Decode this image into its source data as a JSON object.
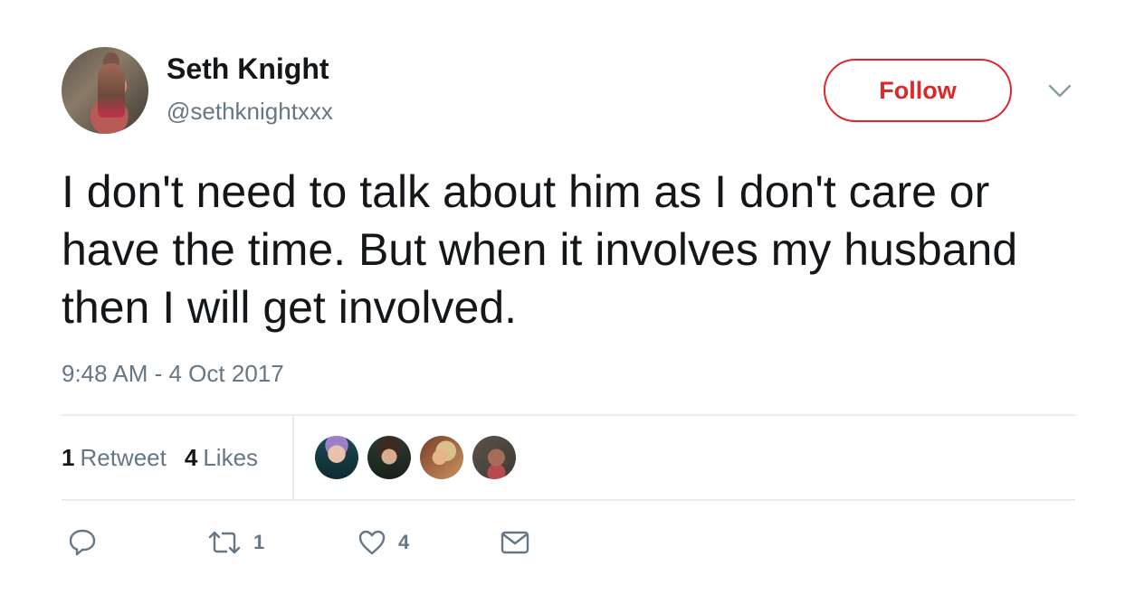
{
  "user": {
    "name": "Seth Knight",
    "handle": "@sethknightxxx",
    "avatar_icon": "user-avatar"
  },
  "follow_button": {
    "label": "Follow",
    "color": "#e0262a"
  },
  "menu_icon": "chevron-down-icon",
  "tweet": {
    "text": "I don't need to talk about him as I don't care or have the time. But when it involves my husband then I will get involved.",
    "timestamp": "9:48 AM - 4 Oct 2017"
  },
  "stats": {
    "retweets_count": "1",
    "retweets_label": "Retweet",
    "likes_count": "4",
    "likes_label": "Likes"
  },
  "likers": [
    {
      "icon": "liker-avatar"
    },
    {
      "icon": "liker-avatar"
    },
    {
      "icon": "liker-avatar"
    },
    {
      "icon": "liker-avatar"
    }
  ],
  "actions": {
    "reply_icon": "reply-icon",
    "retweet_icon": "retweet-icon",
    "retweet_count": "1",
    "like_icon": "heart-icon",
    "like_count": "4",
    "dm_icon": "envelope-icon"
  },
  "colors": {
    "text": "#14171a",
    "secondary": "#657786",
    "divider": "#e6ecf0"
  }
}
